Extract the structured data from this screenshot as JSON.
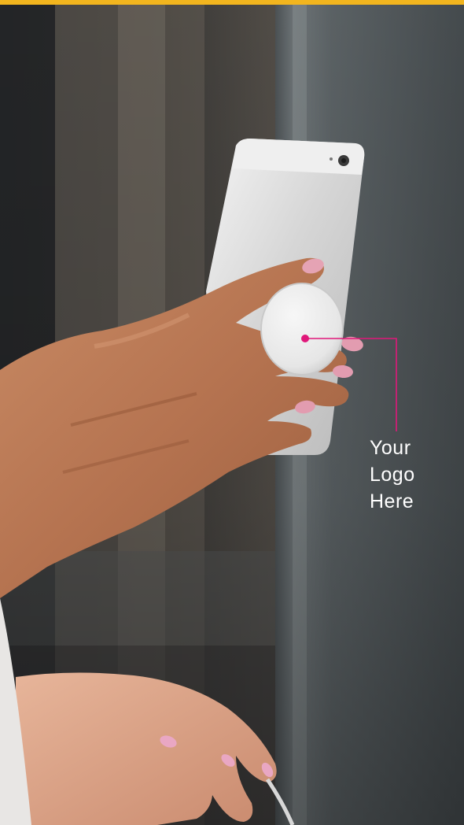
{
  "photo": {
    "subject": "hand-holding-phone-with-phone-grip"
  },
  "callout": {
    "line1": "Your",
    "line2": "Logo",
    "line3": "Here",
    "color": "#e0187a"
  },
  "colors": {
    "top_border": "#f2b51e",
    "grip": "#e9e9e9"
  }
}
